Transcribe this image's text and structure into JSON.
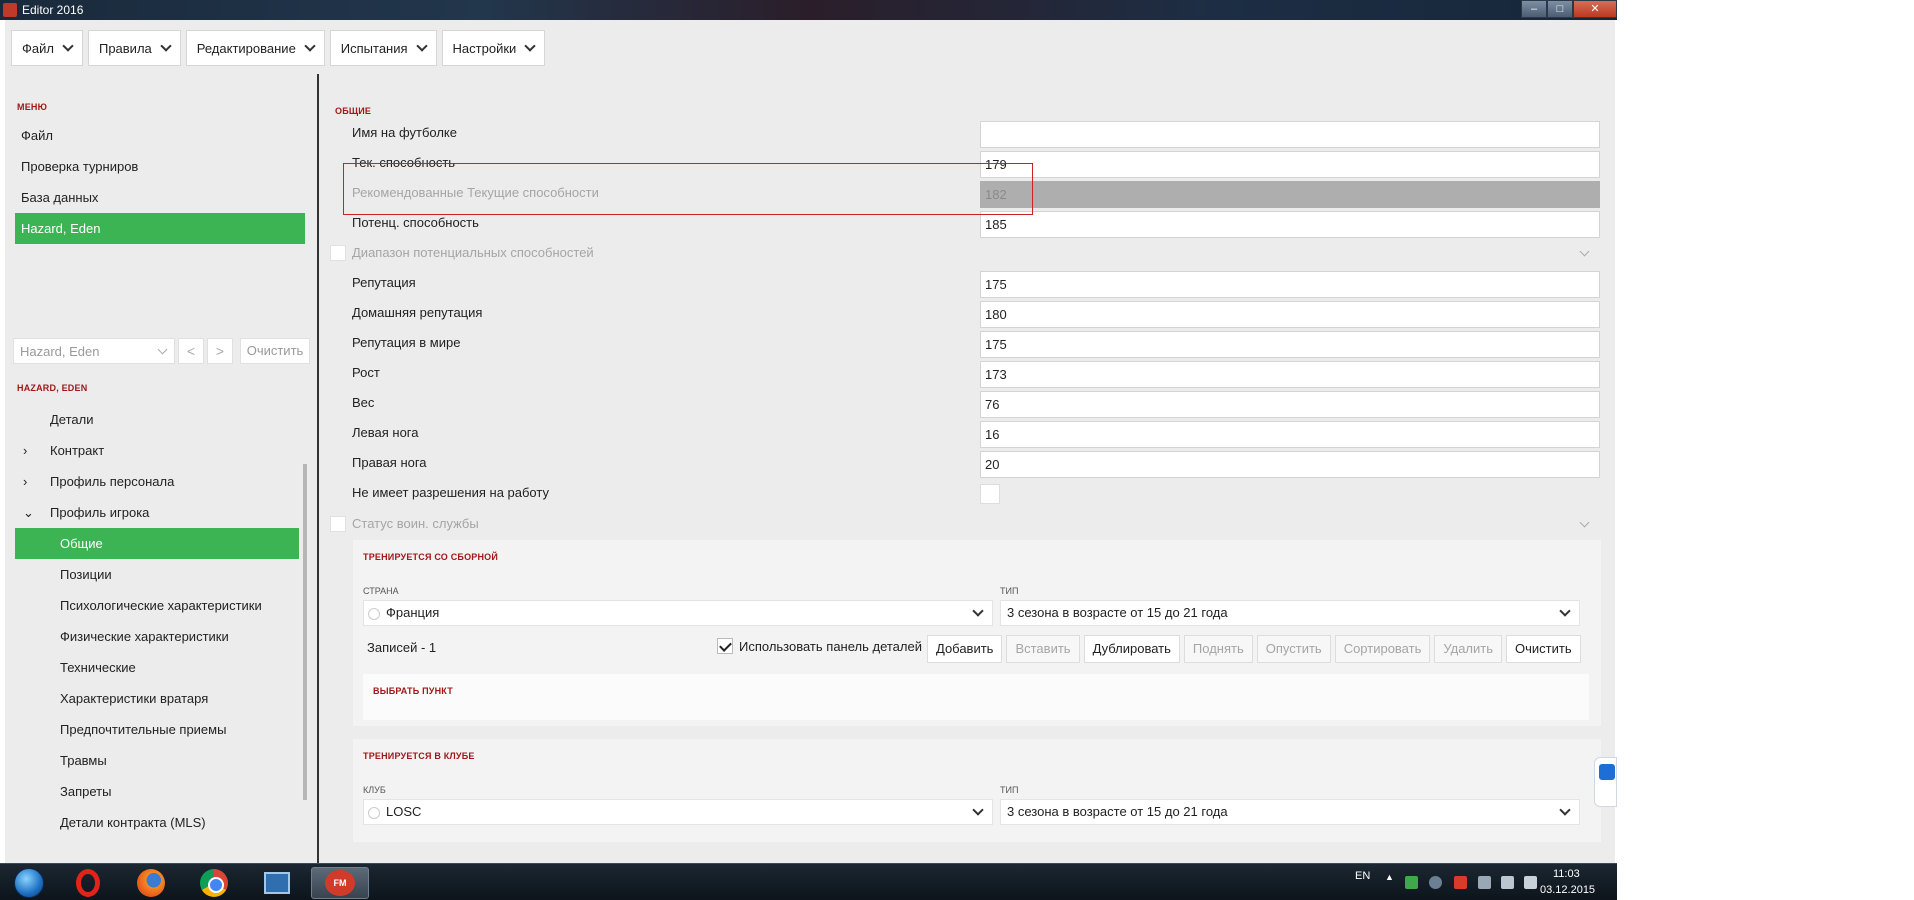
{
  "window": {
    "title": "Editor 2016"
  },
  "topmenu": [
    {
      "label": "Файл"
    },
    {
      "label": "Правила"
    },
    {
      "label": "Редактирование"
    },
    {
      "label": "Испытания"
    },
    {
      "label": "Настройки"
    }
  ],
  "sidebar": {
    "menu_title": "МЕНЮ",
    "menu_items": [
      {
        "label": "Файл",
        "active": false
      },
      {
        "label": "Проверка турниров",
        "active": false
      },
      {
        "label": "База данных",
        "active": false
      },
      {
        "label": "Hazard, Eden",
        "active": true
      }
    ],
    "search": {
      "value": "Hazard, Eden",
      "prev": "<",
      "next": ">",
      "clear_label": "Очистить"
    },
    "player_title": "HAZARD, EDEN",
    "tree": [
      {
        "label": "Детали",
        "level": 1,
        "expander": ""
      },
      {
        "label": "Контракт",
        "level": 1,
        "expander": "›"
      },
      {
        "label": "Профиль персонала",
        "level": 1,
        "expander": "›"
      },
      {
        "label": "Профиль игрока",
        "level": 1,
        "expander": "⌄"
      },
      {
        "label": "Общие",
        "level": 2,
        "active": true
      },
      {
        "label": "Позиции",
        "level": 2
      },
      {
        "label": "Психологические характеристики",
        "level": 2
      },
      {
        "label": "Физические характеристики",
        "level": 2
      },
      {
        "label": "Технические",
        "level": 2
      },
      {
        "label": "Характеристики вратаря",
        "level": 2
      },
      {
        "label": "Предпочтительные приемы",
        "level": 2
      },
      {
        "label": "Травмы",
        "level": 2
      },
      {
        "label": "Запреты",
        "level": 2
      },
      {
        "label": "Детали контракта (MLS)",
        "level": 2
      }
    ]
  },
  "general": {
    "title": "ОБЩИЕ",
    "fields": [
      {
        "label": "Имя на футболке",
        "value": ""
      },
      {
        "label": "Тек. способность",
        "value": "179"
      },
      {
        "label": "Рекомендованные Текущие способности",
        "value": "182"
      },
      {
        "label": "Потенц. способность",
        "value": "185"
      },
      {
        "label": "Диапазон потенциальных способностей",
        "value": ""
      },
      {
        "label": "Репутация",
        "value": "175"
      },
      {
        "label": "Домашняя репутация",
        "value": "180"
      },
      {
        "label": "Репутация в мире",
        "value": "175"
      },
      {
        "label": "Рост",
        "value": "173"
      },
      {
        "label": "Вес",
        "value": "76"
      },
      {
        "label": "Левая нога",
        "value": "16"
      },
      {
        "label": "Правая нога",
        "value": "20"
      },
      {
        "label": "Не имеет разрешения на работу",
        "value": ""
      },
      {
        "label": "Статус воин. службы",
        "value": ""
      }
    ]
  },
  "national_training": {
    "title": "ТРЕНИРУЕТСЯ СО СБОРНОЙ",
    "col_country": "СТРАНА",
    "col_type": "ТИП",
    "country": "Франция",
    "type": "3 сезона в возрасте от 15 до 21 года",
    "records": "Записей - 1",
    "use_details_panel": "Использовать панель деталей",
    "buttons": {
      "add": "Добавить",
      "insert": "Вставить",
      "duplicate": "Дублировать",
      "up": "Поднять",
      "down": "Опустить",
      "sort": "Сортировать",
      "delete": "Удалить",
      "clear": "Очистить"
    },
    "select_item": "ВЫБРАТЬ ПУНКТ"
  },
  "club_training": {
    "title": "ТРЕНИРУЕТСЯ В КЛУБЕ",
    "col_club": "КЛУБ",
    "col_type": "ТИП",
    "club": "LOSC",
    "type": "3 сезона в возрасте от 15 до 21 года"
  },
  "taskbar": {
    "lang": "EN",
    "time": "11:03",
    "date": "03.12.2015",
    "fm_label": "FM"
  }
}
